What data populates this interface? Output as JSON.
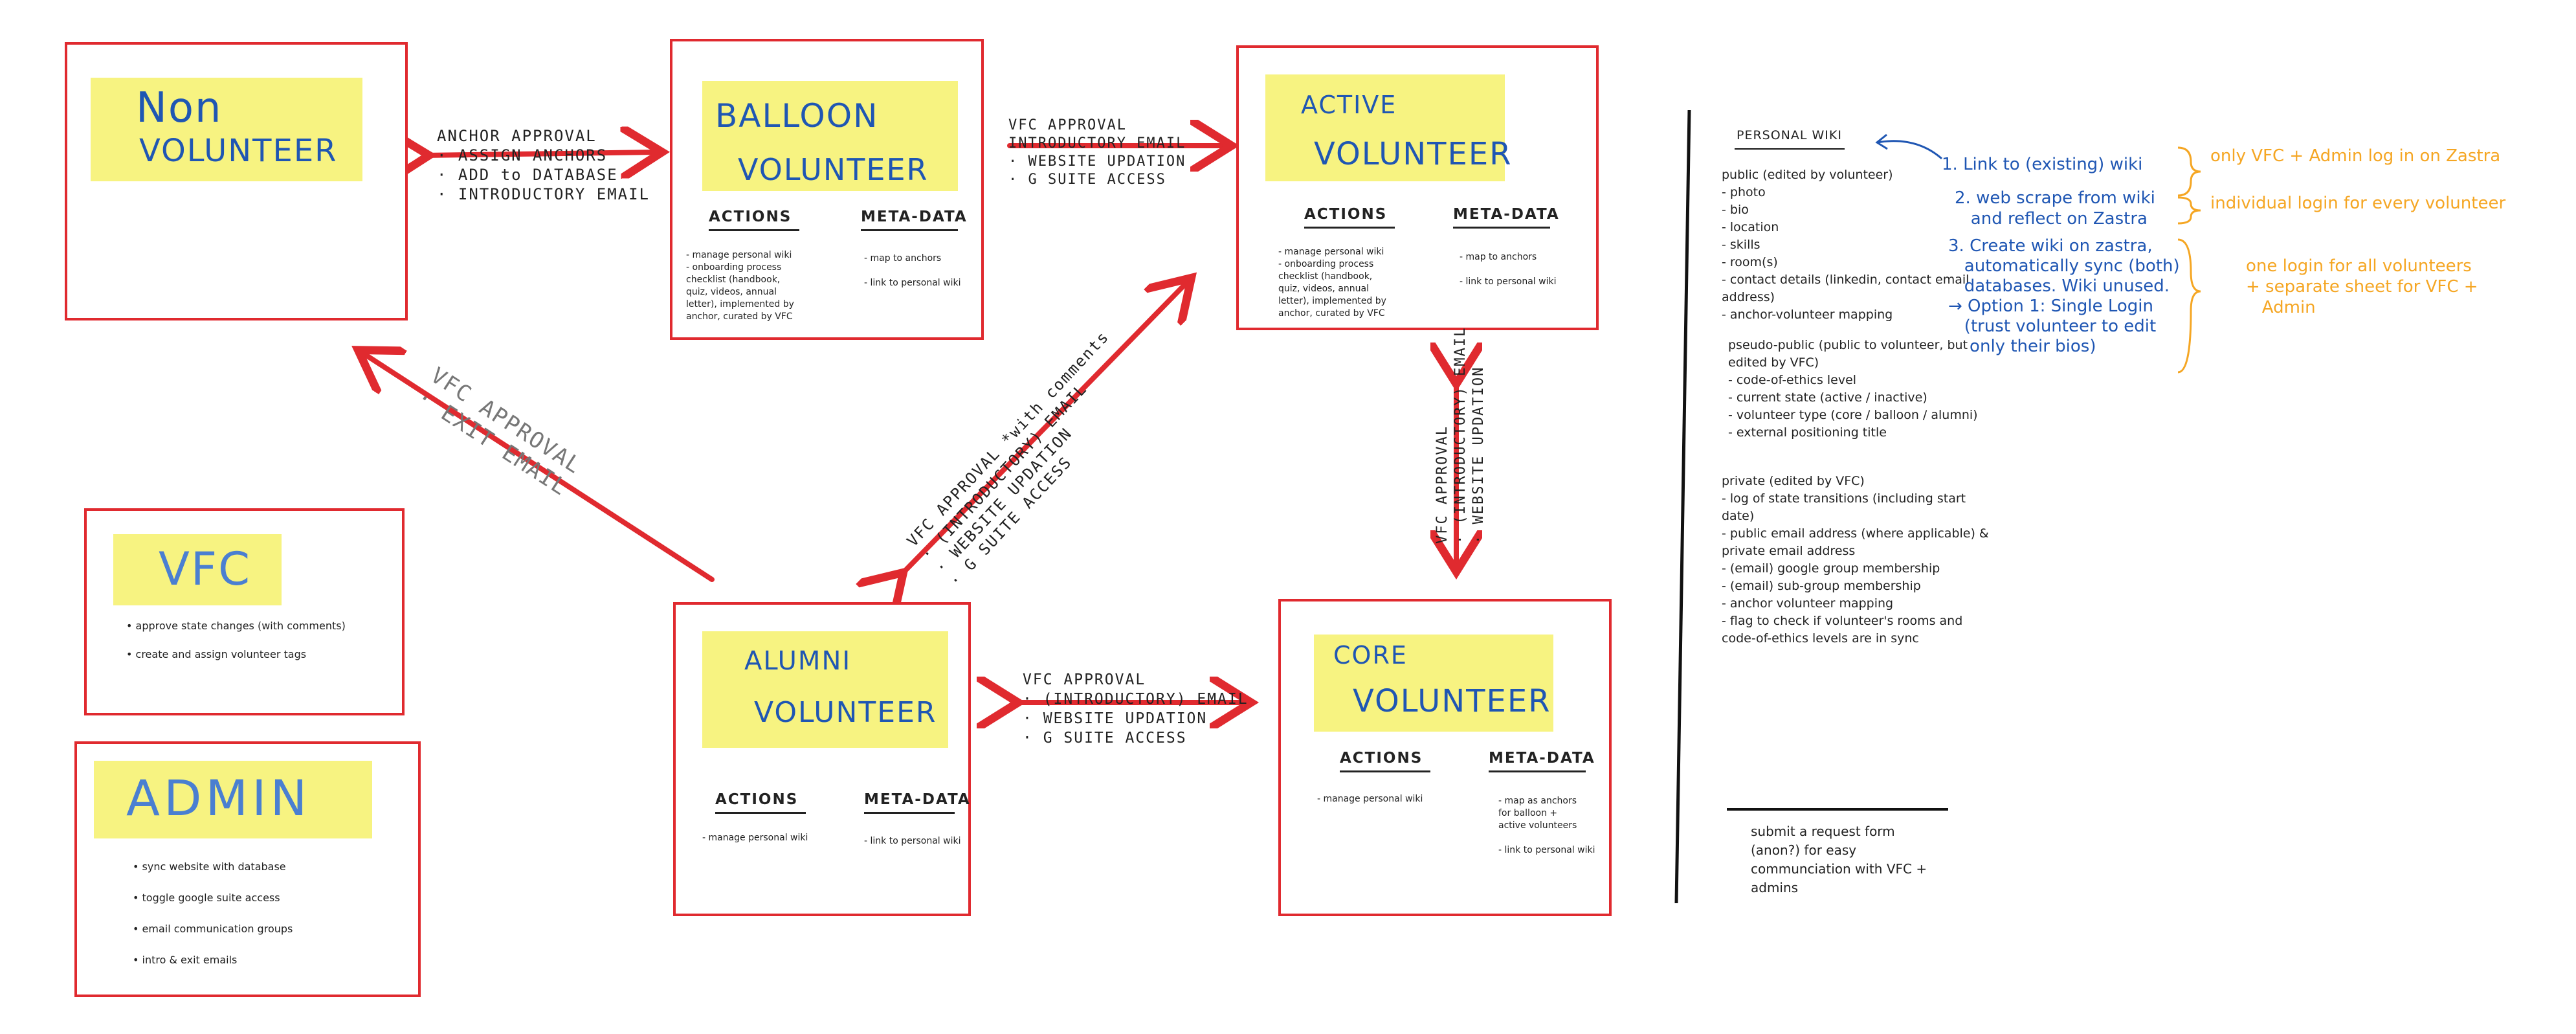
{
  "states": {
    "non": {
      "line1": "Non",
      "line2": "VOLUNTEER"
    },
    "balloon": {
      "line1": "BALLOON",
      "line2": "VOLUNTEER",
      "actions_label": "ACTIONS",
      "meta_label": "META-DATA",
      "actions": "- manage personal wiki\n- onboarding process\n  checklist (handbook,\n  quiz, videos, annual\n  letter), implemented by\n  anchor, curated by VFC",
      "meta": "- map to anchors\n\n- link to personal wiki"
    },
    "active": {
      "line1": "ACTIVE",
      "line2": "VOLUNTEER",
      "actions_label": "ACTIONS",
      "meta_label": "META-DATA",
      "actions": "- manage personal wiki\n- onboarding process\n  checklist (handbook,\n  quiz, videos, annual\n  letter), implemented by\n  anchor, curated by VFC",
      "meta": "- map to anchors\n\n- link to personal wiki"
    },
    "alumni": {
      "line1": "ALUMNI",
      "line2": "VOLUNTEER",
      "actions_label": "ACTIONS",
      "meta_label": "META-DATA",
      "actions": "- manage personal wiki",
      "meta": "- link to personal wiki"
    },
    "core": {
      "line1": "CORE",
      "line2": "VOLUNTEER",
      "actions_label": "ACTIONS",
      "meta_label": "META-DATA",
      "actions": "- manage personal wiki",
      "meta": "- map as anchors\n  for balloon +\n  active volunteers\n\n- link to personal wiki"
    }
  },
  "roles": {
    "vfc": {
      "title": "VFC",
      "items": "• approve state changes (with comments)\n• create and assign volunteer tags"
    },
    "admin": {
      "title": "ADMIN",
      "items": "• sync website with database\n• toggle google suite access\n• email communication groups\n• intro & exit emails"
    }
  },
  "transitions": {
    "non_balloon": "ANCHOR APPROVAL\n· ASSIGN ANCHORS\n· ADD to DATABASE\n· INTRODUCTORY EMAIL",
    "balloon_active": "VFC APPROVAL\nINTRODUCTORY EMAIL\n· WEBSITE UPDATION\n· G SUITE ACCESS",
    "alumni_non": "VFC APPROVAL\n· EXIT EMAIL",
    "alumni_active": "VFC APPROVAL *with comments\n· (INTRODUCTORY) EMAIL\n· WEBSITE UPDATION\n· G SUITE ACCESS",
    "active_core": "VFC APPROVAL\n· (INTRODUCTORY) EMAIL\n· WEBSITE UPDATION",
    "alumni_core": "VFC APPROVAL\n· (INTRODUCTORY) EMAIL\n· WEBSITE UPDATION\n· G SUITE ACCESS"
  },
  "wiki": {
    "title": "PERSONAL WIKI",
    "public": "public (edited by volunteer)\n- photo\n- bio\n- location\n- skills\n- room(s)\n- contact details (linkedin, contact email\naddress)\n- anchor-volunteer mapping",
    "pseudo": "pseudo-public (public to volunteer, but\nedited by VFC)\n- code-of-ethics level\n- current state (active / inactive)\n- volunteer type (core / balloon / alumni)\n- external positioning title",
    "private": "private (edited by VFC)\n- log of state transitions (including start\ndate)\n- public email address (where applicable) &\nprivate email address\n- (email) google group membership\n- (email) sub-group membership\n- anchor volunteer mapping\n- flag to check if volunteer's rooms and\ncode-of-ethics levels are in sync",
    "request": "submit a request form\n(anon?) for easy\ncommunciation with VFC +\nadmins"
  },
  "notes": {
    "opt1": "1. Link to (existing) wiki",
    "opt2": "2. web scrape from wiki\n   and reflect on Zastra",
    "opt3": "3. Create wiki on zastra,\n   automatically sync (both)\n   databases. Wiki unused.\n→ Option 1: Single Login\n   (trust volunteer to edit\n    only their bios)",
    "orange1": "only VFC + Admin log in on Zastra",
    "orange2": "individual login for every volunteer",
    "orange3": "one login for all volunteers\n+ separate sheet for VFC +\n   Admin"
  },
  "colors": {
    "arrow": "#e02a2f",
    "highlight": "#f7f27a",
    "blue_ink": "#1f56b3",
    "orange_ink": "#f5a623"
  }
}
